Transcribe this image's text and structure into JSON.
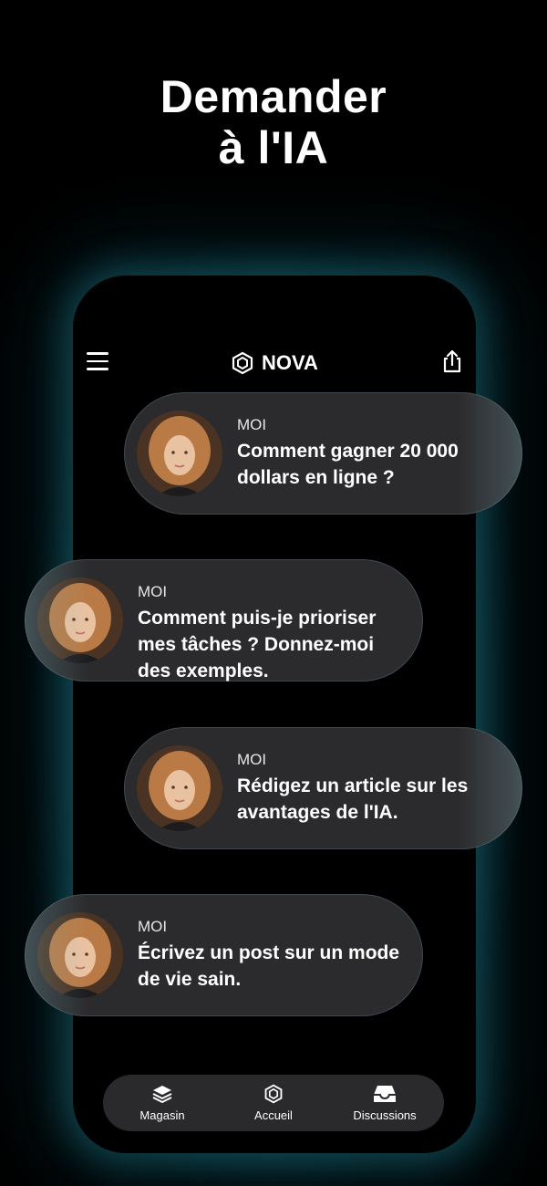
{
  "headline": {
    "line1": "Demander",
    "line2": "à l'IA"
  },
  "header": {
    "brand": "NOVA",
    "menu_icon": "menu-icon",
    "share_icon": "share-icon",
    "logo_icon": "nova-logo-icon"
  },
  "messages": [
    {
      "sender": "MOI",
      "text": "Comment gagner 20 000 dollars en ligne ?"
    },
    {
      "sender": "MOI",
      "text": "Comment puis-je prioriser mes tâches ? Donnez-moi des exemples."
    },
    {
      "sender": "MOI",
      "text": "Rédigez un article sur les avantages de l'IA."
    },
    {
      "sender": "MOI",
      "text": "Écrivez un post sur un mode de vie sain."
    }
  ],
  "nav": [
    {
      "label": "Magasin",
      "icon": "layers-icon"
    },
    {
      "label": "Accueil",
      "icon": "nova-logo-icon"
    },
    {
      "label": "Discussions",
      "icon": "inbox-icon"
    }
  ],
  "colors": {
    "background": "#000000",
    "bubble": "#2c2c2e",
    "glow": "#1e7a8c",
    "text": "#ffffff"
  }
}
